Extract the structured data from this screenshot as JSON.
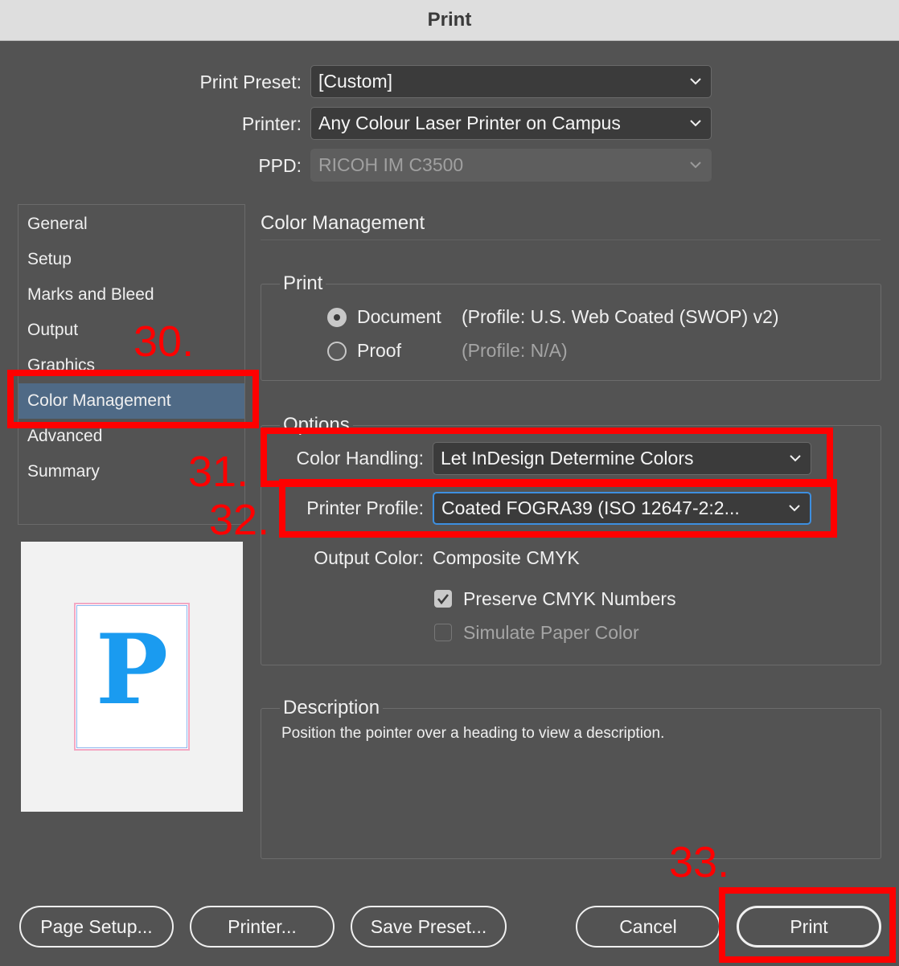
{
  "window": {
    "title": "Print"
  },
  "top_fields": {
    "print_preset": {
      "label": "Print Preset:",
      "value": "[Custom]"
    },
    "printer": {
      "label": "Printer:",
      "value": "Any Colour Laser Printer on Campus"
    },
    "ppd": {
      "label": "PPD:",
      "value": "RICOH IM C3500"
    }
  },
  "sidebar": {
    "items": [
      {
        "label": "General"
      },
      {
        "label": "Setup"
      },
      {
        "label": "Marks and Bleed"
      },
      {
        "label": "Output"
      },
      {
        "label": "Graphics"
      },
      {
        "label": "Color Management",
        "selected": true
      },
      {
        "label": "Advanced"
      },
      {
        "label": "Summary"
      }
    ]
  },
  "preview": {
    "glyph": "P",
    "glyph_color": "#1a9bf0"
  },
  "panel": {
    "heading": "Color Management",
    "print_group": {
      "legend": "Print",
      "document": {
        "label": "Document",
        "profile": "(Profile: U.S. Web Coated (SWOP) v2)",
        "selected": true
      },
      "proof": {
        "label": "Proof",
        "profile": "(Profile: N/A)",
        "selected": false
      }
    },
    "options_group": {
      "legend": "Options",
      "color_handling": {
        "label": "Color Handling:",
        "value": "Let InDesign Determine Colors"
      },
      "printer_profile": {
        "label": "Printer Profile:",
        "value": "Coated FOGRA39 (ISO 12647-2:2..."
      },
      "output_color": {
        "label": "Output Color:",
        "value": "Composite CMYK"
      },
      "preserve_cmyk": {
        "label": "Preserve CMYK Numbers",
        "checked": true
      },
      "simulate_paper": {
        "label": "Simulate Paper Color",
        "checked": false,
        "disabled": true
      }
    },
    "description_group": {
      "legend": "Description",
      "text": "Position the pointer over a heading to view a description."
    }
  },
  "buttons": {
    "page_setup": "Page Setup...",
    "printer": "Printer...",
    "save_preset": "Save Preset...",
    "cancel": "Cancel",
    "print": "Print"
  },
  "annotations": {
    "color": "#ff0000",
    "labels": [
      "30.",
      "31.",
      "32.",
      "33."
    ]
  }
}
